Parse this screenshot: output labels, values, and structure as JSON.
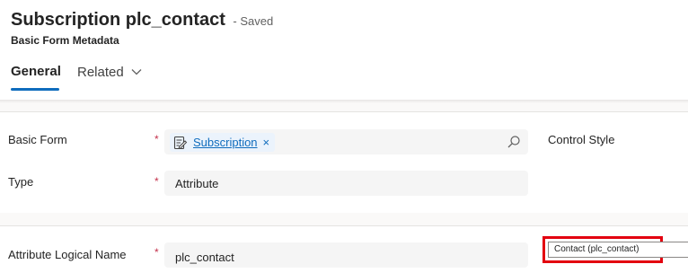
{
  "header": {
    "title": "Subscription plc_contact",
    "status": "- Saved",
    "subtitle": "Basic Form Metadata"
  },
  "tabs": [
    {
      "label": "General",
      "selected": true
    },
    {
      "label": "Related",
      "selected": false
    }
  ],
  "icons": {
    "related_chevron": "chevron-down-icon",
    "lookup_record": "form-edit-icon",
    "remove": "close-icon",
    "search": "search-icon"
  },
  "colors": {
    "accent": "#0f6cbd",
    "required": "#c4314b",
    "highlight": "#e3000f"
  },
  "form": {
    "basic_form": {
      "label": "Basic Form",
      "required_mark": "*",
      "value": "Subscription",
      "remove_glyph": "×"
    },
    "type": {
      "label": "Type",
      "required_mark": "*",
      "value": "Attribute"
    },
    "control_style": {
      "label": "Control Style"
    },
    "attribute_logical_name": {
      "label": "Attribute Logical Name",
      "required_mark": "*",
      "value": "plc_contact"
    },
    "attribute_picker": {
      "value": "Contact (plc_contact)"
    }
  }
}
